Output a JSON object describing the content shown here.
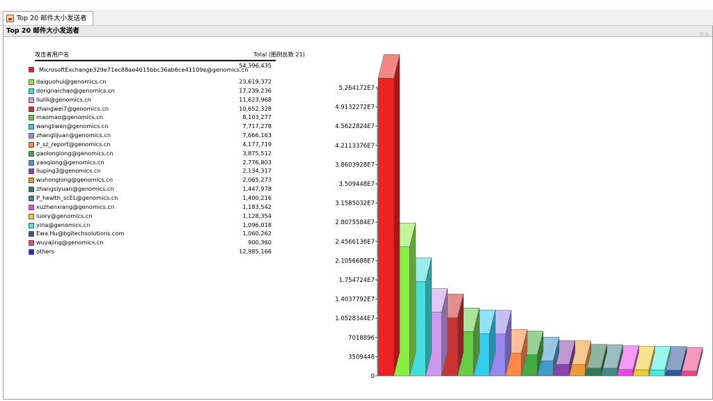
{
  "window": {
    "tab_label": "Top 20 邮件大小发送者",
    "panel_title": "Top 20 邮件大小发送者"
  },
  "legend": {
    "header_user": "攻击者用户名",
    "header_total": "Total (图例总数 21)"
  },
  "chart_data": {
    "type": "bar",
    "title": "Top 20 邮件大小发送者",
    "categories": [
      "MicrosoftExchange329e71ec88ae4615bbc36ab6ce41109e@genomics.cn",
      "daiguohui@genomics.cn",
      "dongnaichao@genomics.cn",
      "liulili@genomics.cn",
      "zhangwei7@genomics.cn",
      "maomao@genomics.cn",
      "wangliwen@genomics.cn",
      "zhanglijuan@genomics.cn",
      "P_sz_report@genomics.cn",
      "gaolonglong@genomics.cn",
      "yaoqiong@genomics.cn",
      "liuping3@genomics.cn",
      "wuhonglong@genomics.cn",
      "zhangsiyuan@genomics.cn",
      "P_health_scEL@genomics.cn",
      "xuzhenxiang@genomics.cn",
      "luory@genomics.cn",
      "yina@genomics.cn",
      "Ewa.Hu@bgitechsolutions.com",
      "wuyajing@genomics.cn",
      "others"
    ],
    "values": [
      54396435,
      23619372,
      17239236,
      11623968,
      10652328,
      8103277,
      7717278,
      7666163,
      4177719,
      3875512,
      2776803,
      2134317,
      2065273,
      1447978,
      1400216,
      1183542,
      1128354,
      1096018,
      1060262,
      900360,
      12985166
    ],
    "display_values": [
      "54,396,435",
      "23,619,372",
      "17,239,236",
      "11,623,968",
      "10,652,328",
      "8,103,277",
      "7,717,278",
      "7,666,163",
      "4,177,719",
      "3,875,512",
      "2,776,803",
      "2,134,317",
      "2,065,273",
      "1,447,978",
      "1,400,216",
      "1,183,542",
      "1,128,354",
      "1,096,018",
      "1,060,262",
      "900,360",
      "12,985,166"
    ],
    "colors": [
      "#ee2222",
      "#88ee44",
      "#44dddd",
      "#cc99ee",
      "#cc3333",
      "#66cc44",
      "#33ccee",
      "#9988ee",
      "#ff8844",
      "#44aa44",
      "#4499cc",
      "#8844aa",
      "#ee9933",
      "#337755",
      "#448888",
      "#ee44ee",
      "#eecc33",
      "#44eedd",
      "#335599",
      "#ee4488",
      "#2222dd"
    ],
    "ylim": [
      0,
      52641720
    ],
    "yticks": [
      "0",
      "3509448",
      "7018896",
      "1.0528344E7",
      "1.4037792E7",
      "1.754724E7",
      "2.1056688E7",
      "2.4566136E7",
      "2.8075584E7",
      "3.1585032E7",
      "3.509448E7",
      "3.8603928E7",
      "4.2113376E7",
      "4.5622824E7",
      "4.9132272E7",
      "5.264172E7"
    ],
    "ytick_values": [
      0,
      3509448,
      7018896,
      10528344,
      14037792,
      17547240,
      21056688,
      24566136,
      28075584,
      31585032,
      35094480,
      38603928,
      42113376,
      45622824,
      49132272,
      52641720
    ],
    "bars_plotted": 20,
    "grid": false
  }
}
